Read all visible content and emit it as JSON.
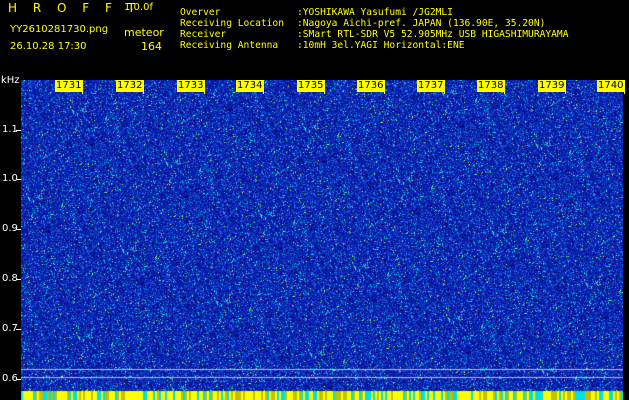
{
  "header": {
    "app_name": "H R O F F T",
    "version": "1.0.0f",
    "filename": "YY2610281730.png",
    "datetime": "26.10.28 17:30",
    "mode": "meteor",
    "count": "164"
  },
  "meta": [
    {
      "label": "Overver",
      "value": ":YOSHIKAWA Yasufumi /JG2MLI"
    },
    {
      "label": "Receiving Location",
      "value": ":Nagoya Aichi-pref. JAPAN (136.90E, 35.20N)"
    },
    {
      "label": "Receiver",
      "value": ":SMart RTL-SDR V5 52.905MHz USB HIGASHIMURAYAMA"
    },
    {
      "label": "Receiving Antenna",
      "value": ":10mH 3el.YAGI Horizontal:ENE"
    }
  ],
  "axis": {
    "y_unit": "kHz",
    "y_ticks": [
      "1.1",
      "1.0",
      "0.9",
      "0.8",
      "0.7",
      "0.6"
    ],
    "x_ticks": [
      "1731",
      "1732",
      "1733",
      "1734",
      "1735",
      "1736",
      "1737",
      "1738",
      "1739",
      "1740"
    ]
  },
  "colors": {
    "background": "#000000",
    "label": "#ffff00",
    "spectrogram_base": "#0a1aa8"
  }
}
